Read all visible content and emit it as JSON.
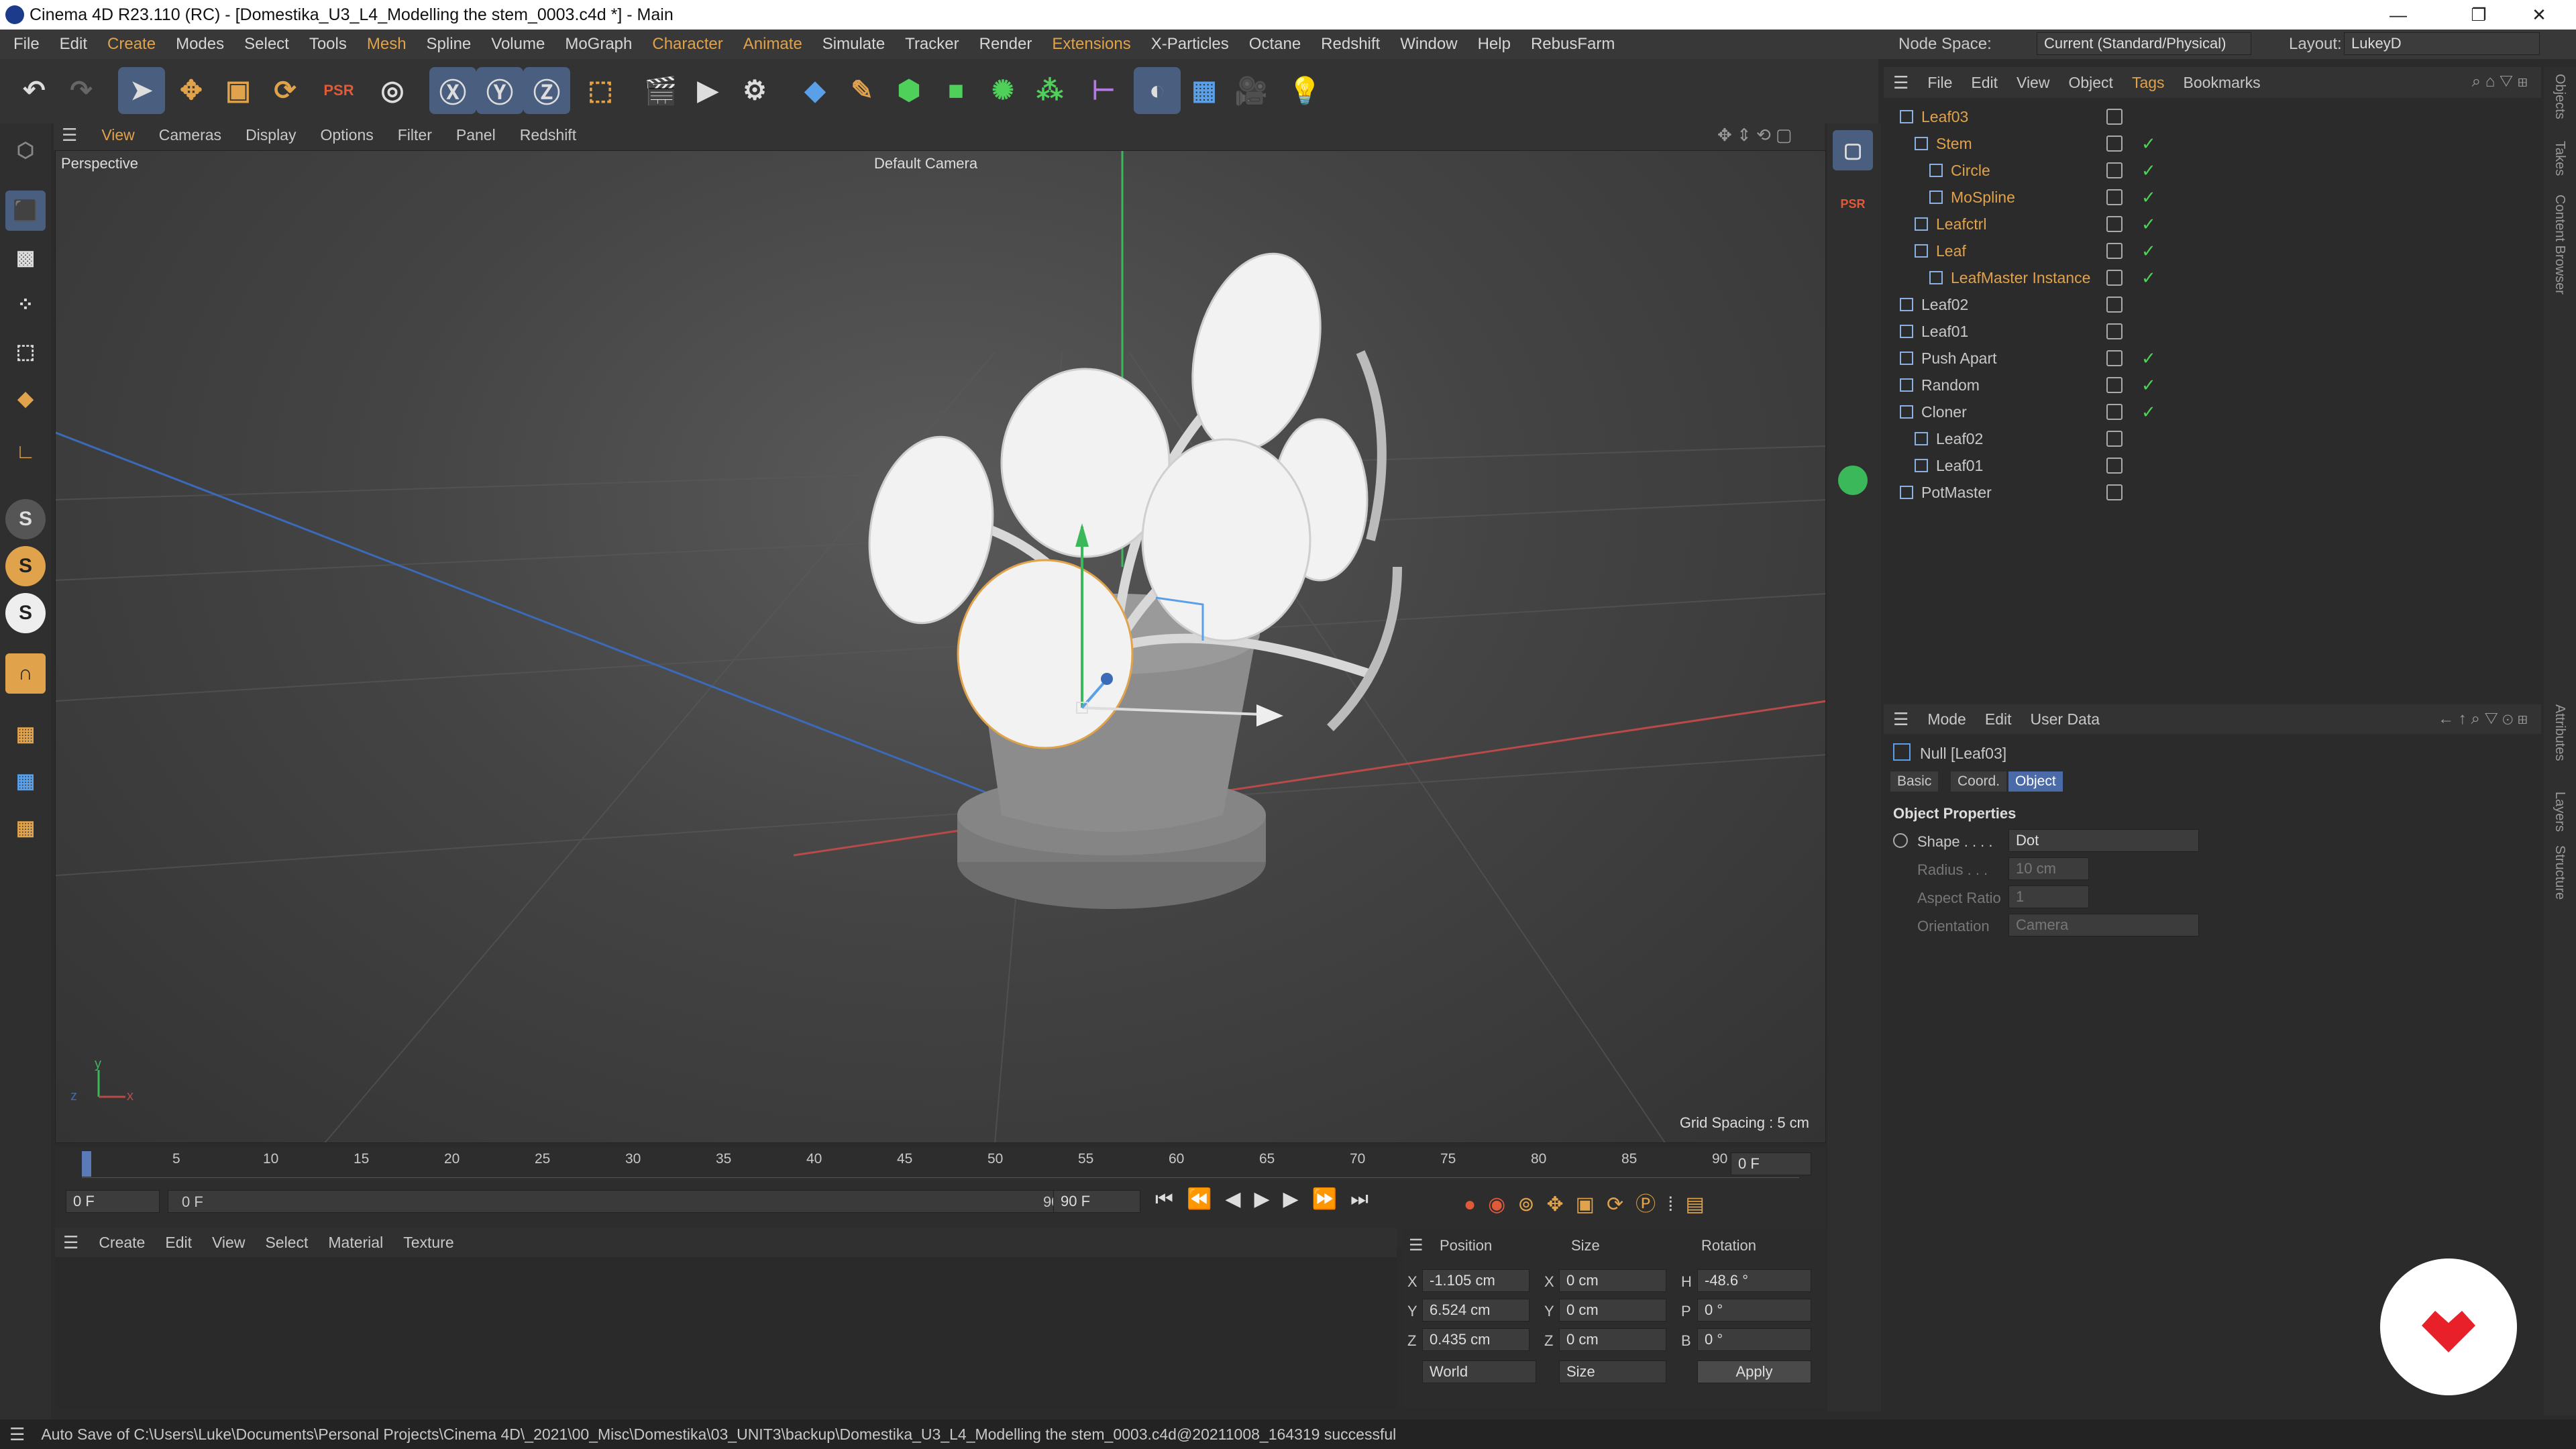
{
  "window": {
    "title": "Cinema 4D R23.110 (RC) - [Domestika_U3_L4_Modelling the stem_0003.c4d *] - Main",
    "controls": [
      "—",
      "❐",
      "✕"
    ]
  },
  "menubar": {
    "items": [
      "File",
      "Edit",
      "Create",
      "Modes",
      "Select",
      "Tools",
      "Mesh",
      "Spline",
      "Volume",
      "MoGraph",
      "Character",
      "Animate",
      "Simulate",
      "Tracker",
      "Render",
      "Extensions",
      "X-Particles",
      "Octane",
      "Redshift",
      "Window",
      "Help",
      "RebusFarm"
    ],
    "node_space_label": "Node Space:",
    "node_space_value": "Current (Standard/Physical)",
    "layout_label": "Layout:",
    "layout_value": "LukeyD"
  },
  "viewport": {
    "menu": [
      "View",
      "Cameras",
      "Display",
      "Options",
      "Filter",
      "Panel",
      "Redshift"
    ],
    "name": "Perspective",
    "camera": "Default Camera",
    "grid_spacing": "Grid Spacing : 5 cm",
    "axis_x": "x",
    "axis_y": "y",
    "axis_z": "z"
  },
  "object_manager": {
    "menu": [
      "File",
      "Edit",
      "View",
      "Object",
      "Tags",
      "Bookmarks"
    ],
    "rows": [
      {
        "name": "Leaf03",
        "color": "#e0a24a"
      },
      {
        "name": "Stem",
        "color": "#e0a24a"
      },
      {
        "name": "Circle",
        "color": "#e0a24a"
      },
      {
        "name": "MoSpline",
        "color": "#e0a24a"
      },
      {
        "name": "Leafctrl",
        "color": "#e0a24a"
      },
      {
        "name": "Leaf",
        "color": "#e0a24a"
      },
      {
        "name": "LeafMaster Instance",
        "color": "#e0a24a"
      },
      {
        "name": "Leaf02",
        "color": "#c8c8c8"
      },
      {
        "name": "Leaf01",
        "color": "#c8c8c8"
      },
      {
        "name": "Push Apart",
        "color": "#c8c8c8"
      },
      {
        "name": "Random",
        "color": "#c8c8c8"
      },
      {
        "name": "Cloner",
        "color": "#c8c8c8"
      },
      {
        "name": "Leaf02",
        "color": "#c8c8c8"
      },
      {
        "name": "Leaf01",
        "color": "#c8c8c8"
      },
      {
        "name": "PotMaster",
        "color": "#c8c8c8"
      }
    ]
  },
  "attributes": {
    "menu": [
      "Mode",
      "Edit",
      "User Data"
    ],
    "object": "Null [Leaf03]",
    "tabs": [
      "Basic",
      "Coord.",
      "Object"
    ],
    "section": "Object Properties",
    "shape_label": "Shape . . . .",
    "shape_value": "Dot",
    "radius_label": "Radius . . .",
    "radius_value": "10 cm",
    "aspect_label": "Aspect Ratio",
    "aspect_value": "1",
    "orient_label": "Orientation",
    "orient_value": "Camera"
  },
  "right_tabs": [
    "Objects",
    "Takes",
    "Content Browser",
    "Attributes",
    "Layers",
    "Structure"
  ],
  "timeline": {
    "ticks": [
      "0",
      "5",
      "10",
      "15",
      "20",
      "25",
      "30",
      "35",
      "40",
      "45",
      "50",
      "55",
      "60",
      "65",
      "70",
      "75",
      "80",
      "85",
      "90"
    ],
    "current_frame": "0 F",
    "start": "0 F",
    "range_start": "0 F",
    "range_end": "90 F",
    "end": "90 F"
  },
  "materials": {
    "menu": [
      "Create",
      "Edit",
      "View",
      "Select",
      "Material",
      "Texture"
    ]
  },
  "coords": {
    "headers": [
      "Position",
      "Size",
      "Rotation"
    ],
    "pos": {
      "x": "-1.105 cm",
      "y": "6.524 cm",
      "z": "0.435 cm"
    },
    "size": {
      "x": "0 cm",
      "y": "0 cm",
      "z": "0 cm"
    },
    "rot": {
      "h": "-48.6 °",
      "p": "0 °",
      "b": "0 °"
    },
    "labels": {
      "x": "X",
      "y": "Y",
      "z": "Z",
      "h": "H",
      "p": "P",
      "b": "B"
    },
    "world": "World",
    "sizemode": "Size",
    "apply": "Apply"
  },
  "status": "Auto Save of C:\\Users\\Luke\\Documents\\Personal Projects\\Cinema 4D\\_2021\\00_Misc\\Domestika\\03_UNIT3\\backup\\Domestika_U3_L4_Modelling the stem_0003.c4d@20211008_164319 successful"
}
